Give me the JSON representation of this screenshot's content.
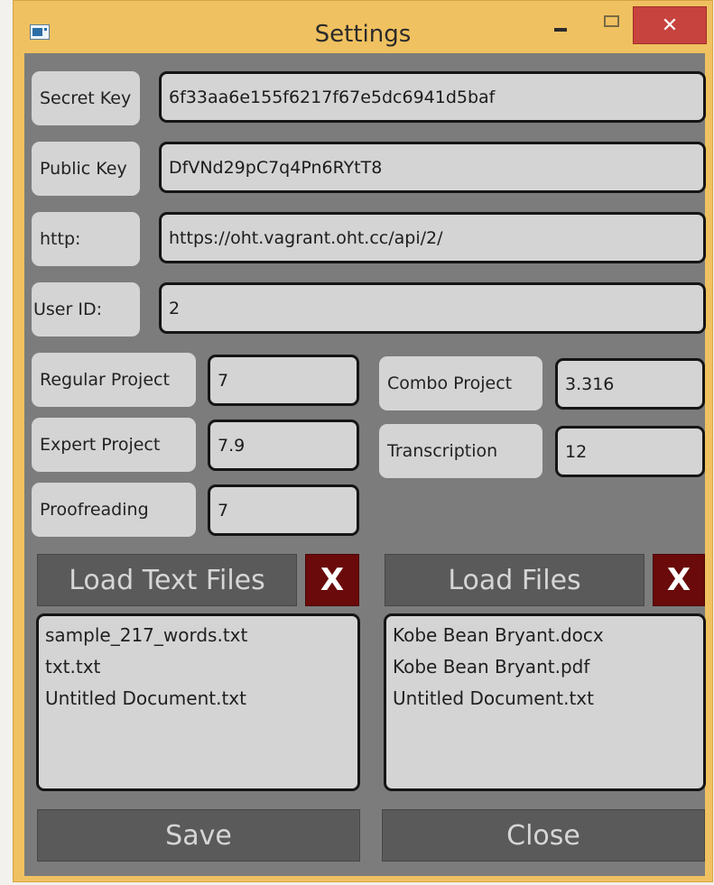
{
  "window": {
    "title": "Settings",
    "close_glyph": "✕"
  },
  "credentials": {
    "secret_key": {
      "label": "Secret Key",
      "value": "6f33aa6e155f6217f67e5dc6941d5baf"
    },
    "public_key": {
      "label": "Public Key",
      "value": "DfVNd29pC7q4Pn6RYtT8"
    },
    "http": {
      "label": "http:",
      "value": "https://oht.vagrant.oht.cc/api/2/"
    },
    "user_id": {
      "label": "User ID:",
      "value": "2"
    }
  },
  "rates": {
    "regular_project": {
      "label": "Regular Project",
      "value": "7"
    },
    "expert_project": {
      "label": "Expert Project",
      "value": "7.9"
    },
    "proofreading": {
      "label": "Proofreading",
      "value": "7"
    },
    "combo_project": {
      "label": "Combo Project",
      "value": "3.316"
    },
    "transcription": {
      "label": "Transcription",
      "value": "12"
    }
  },
  "text_files": {
    "load_label": "Load Text Files",
    "clear_label": "X",
    "items": [
      "sample_217_words.txt",
      "txt.txt",
      "Untitled Document.txt"
    ]
  },
  "files": {
    "load_label": "Load Files",
    "clear_label": "X",
    "items": [
      "Kobe Bean Bryant.docx",
      "Kobe Bean Bryant.pdf",
      "Untitled Document.txt"
    ]
  },
  "actions": {
    "save_label": "Save",
    "close_label": "Close"
  },
  "colors": {
    "title_bar": "#f0c160",
    "client_background": "#7c7c7c",
    "field_background": "#d4d4d4",
    "button_background": "#5a5a5a",
    "clear_button": "#6a0a0a",
    "close_window_button": "#c7433d"
  }
}
